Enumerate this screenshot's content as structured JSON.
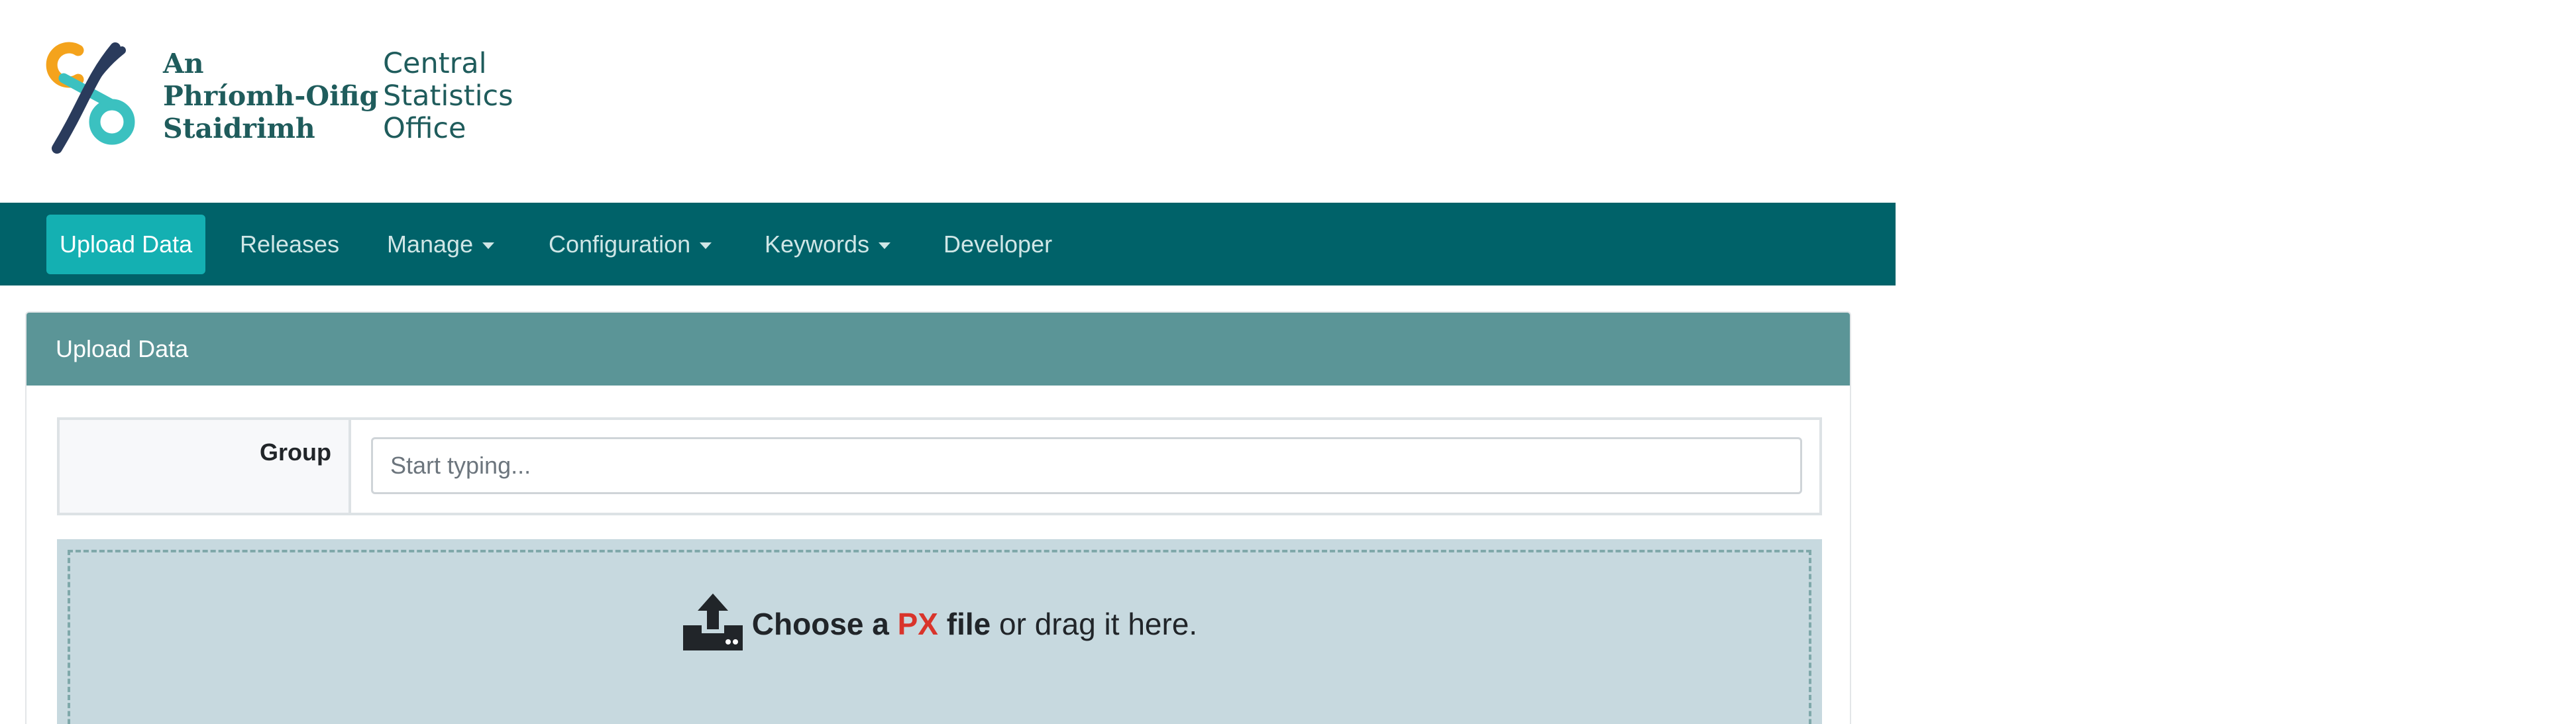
{
  "logo": {
    "irish_lines": [
      "An",
      "Phríomh-Oifig",
      "Staidrimh"
    ],
    "english_lines": [
      "Central",
      "Statistics",
      "Office"
    ],
    "colors": {
      "orange": "#f4a31c",
      "navy": "#2a3b5c",
      "teal": "#3bc1c0"
    }
  },
  "nav": {
    "items": [
      {
        "label": "Upload Data",
        "active": true
      },
      {
        "label": "Releases"
      },
      {
        "label": "Manage",
        "dropdown": true
      },
      {
        "label": "Configuration",
        "dropdown": true
      },
      {
        "label": "Keywords",
        "dropdown": true
      },
      {
        "label": "Developer"
      }
    ]
  },
  "card": {
    "title": "Upload Data",
    "group": {
      "label": "Group",
      "placeholder": "Start typing...",
      "value": ""
    },
    "dropzone": {
      "icon": "upload-tray-icon",
      "choose_a": "Choose a",
      "px": "PX",
      "file": "file",
      "rest": "or drag it here."
    }
  },
  "colors": {
    "navbar": "#006269",
    "active_nav": "#14b0b2",
    "card_header": "#5b9597",
    "dropzone": "#c7d9df",
    "accent_red": "#d9342b"
  }
}
